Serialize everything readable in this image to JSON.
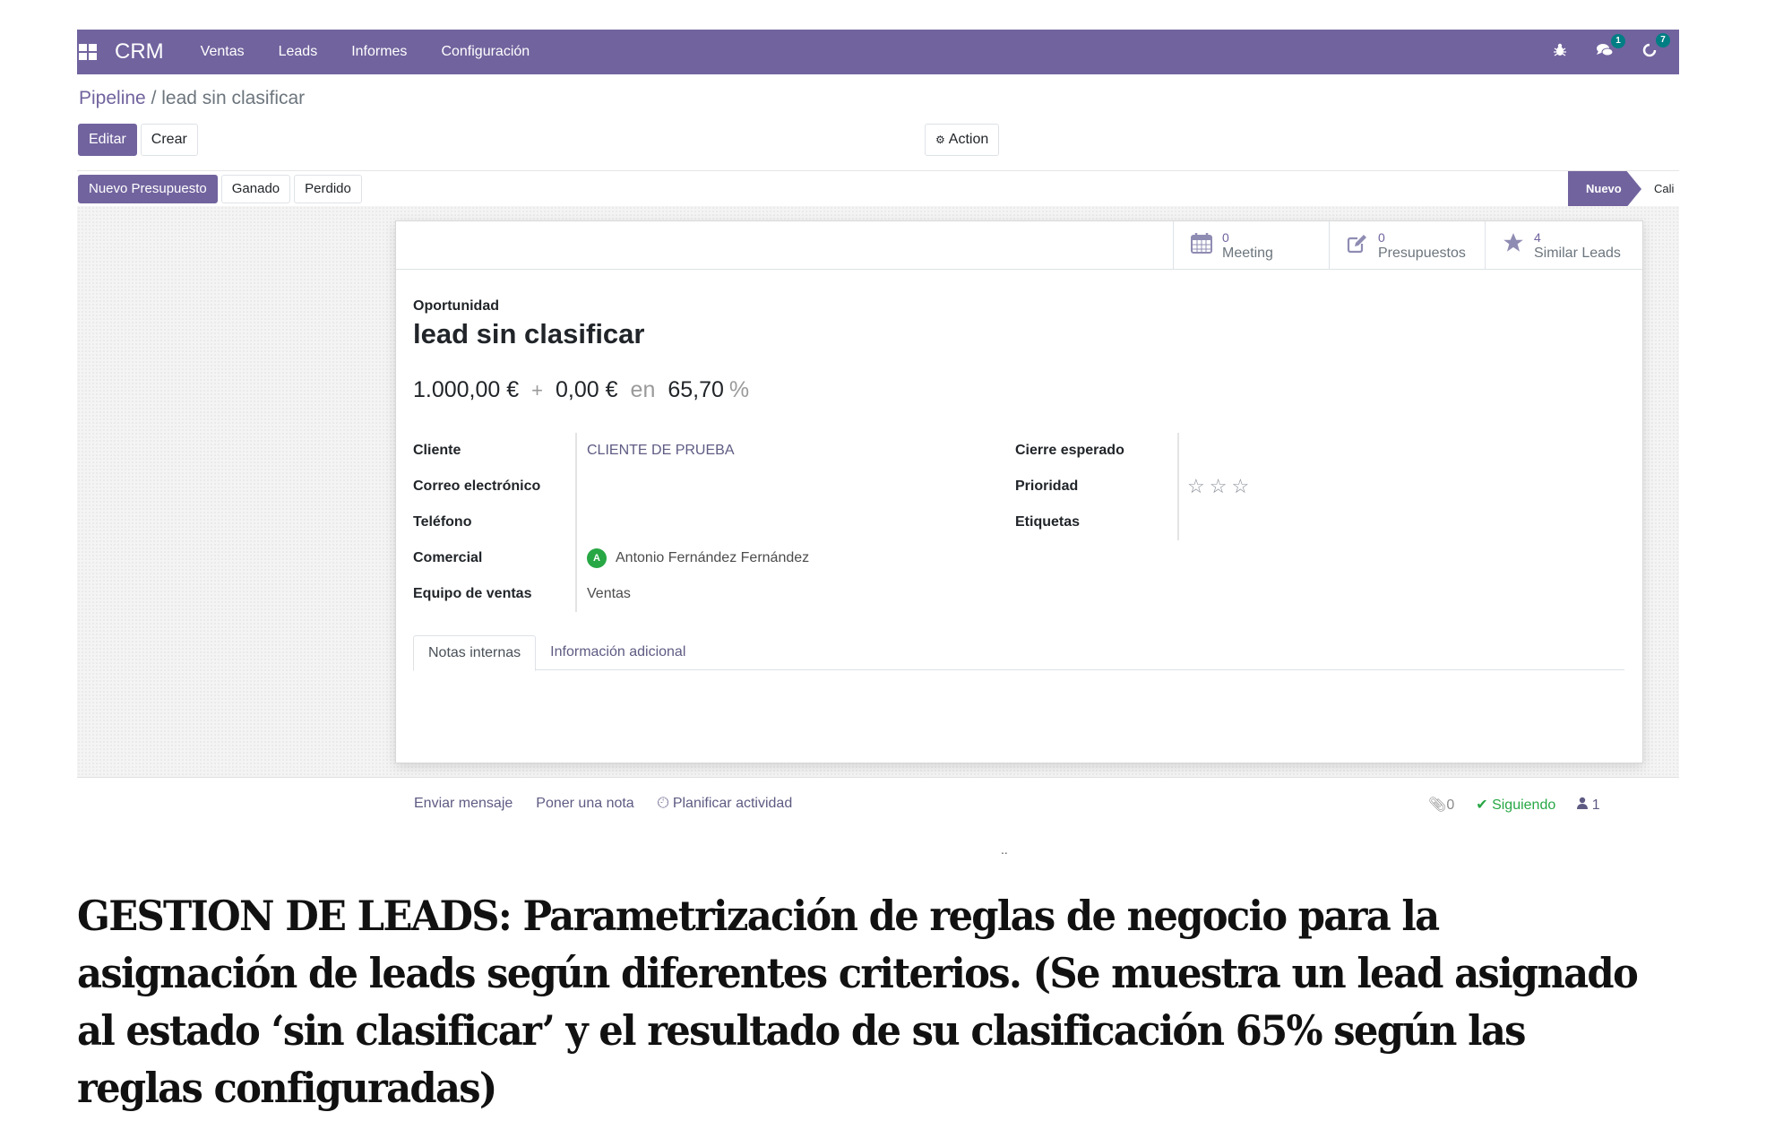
{
  "navbar": {
    "app_name": "CRM",
    "menu": [
      "Ventas",
      "Leads",
      "Informes",
      "Configuración"
    ],
    "icons": {
      "debug": "bug-icon",
      "messages": "chat-icon",
      "activities": "clock-icon"
    },
    "messages_count": "1",
    "activities_count": "7",
    "color": "#71639e"
  },
  "breadcrumb": {
    "parent": "Pipeline",
    "separator": "/",
    "current": "lead sin clasificar"
  },
  "toolbar": {
    "edit_label": "Editar",
    "create_label": "Crear",
    "action_label": "Action"
  },
  "statusbar": {
    "buttons": [
      "Nuevo Presupuesto",
      "Ganado",
      "Perdido"
    ],
    "stages": [
      "Nuevo",
      "Cali"
    ],
    "active_stage": "Nuevo"
  },
  "smart_buttons": [
    {
      "icon": "calendar-icon",
      "value": "0",
      "label": "Meeting"
    },
    {
      "icon": "edit-icon",
      "value": "0",
      "label": "Presupuestos"
    },
    {
      "icon": "star-icon",
      "value": "4",
      "label": "Similar Leads"
    }
  ],
  "form": {
    "type_label": "Oportunidad",
    "title": "lead sin clasificar",
    "expected_revenue": "1.000,00 €",
    "plus": "+",
    "recurring_revenue": "0,00 €",
    "at_label": "en",
    "probability": "65,70",
    "percent_sign": "%",
    "left_fields": [
      {
        "label": "Cliente",
        "value": "CLIENTE DE PRUEBA"
      },
      {
        "label": "Correo electrónico",
        "value": ""
      },
      {
        "label": "Teléfono",
        "value": ""
      },
      {
        "label": "Comercial",
        "value": "Antonio Fernández Fernández",
        "avatar_initial": "A"
      },
      {
        "label": "Equipo de ventas",
        "value": "Ventas"
      }
    ],
    "right_fields": [
      {
        "label": "Cierre esperado",
        "value": ""
      },
      {
        "label": "Prioridad",
        "value": "0 of 3 stars"
      },
      {
        "label": "Etiquetas",
        "value": ""
      }
    ],
    "priority": {
      "filled": 0,
      "max": 3
    },
    "tabs": [
      "Notas internas",
      "Información adicional"
    ],
    "active_tab": "Notas internas"
  },
  "chatter": {
    "send_message": "Enviar mensaje",
    "log_note": "Poner una nota",
    "schedule_activity": "Planificar actividad",
    "attachments": "0",
    "following": "Siguiendo",
    "followers": "1"
  },
  "misc": {
    "dots": ".."
  },
  "caption": "GESTION DE LEADS: Parametrización de reglas de negocio para la asignación de leads según diferentes criterios. (Se muestra un lead asignado al estado ‘sin clasificar’ y el resultado de su clasificación 65% según las reglas configuradas)"
}
